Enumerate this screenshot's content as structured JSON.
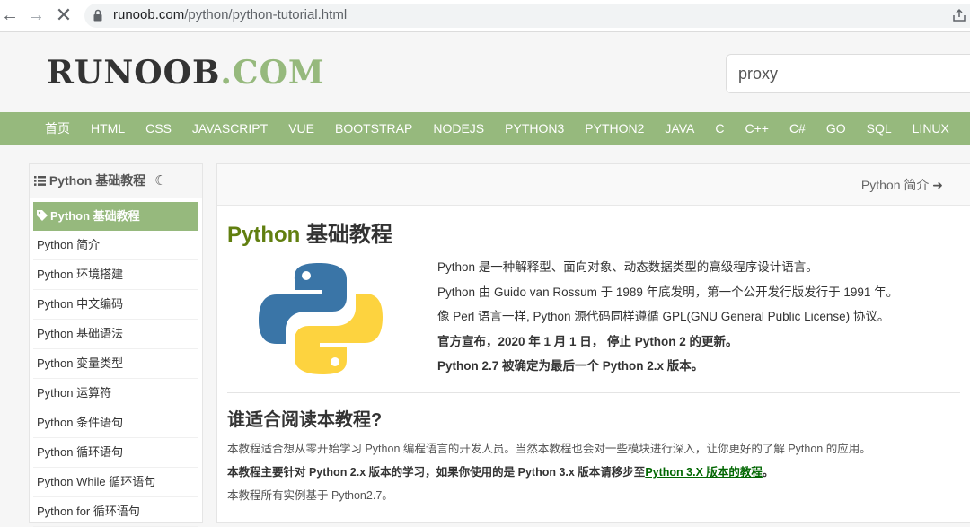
{
  "browser": {
    "url_host": "runoob.com",
    "url_path": "/python/python-tutorial.html",
    "back_icon": "arrow-left-icon",
    "forward_icon": "arrow-right-icon",
    "reload_icon": "stop-loading-icon"
  },
  "header": {
    "logo_main": "RUNOOB",
    "logo_dot": ".",
    "logo_com": "COM",
    "search_value": "proxy"
  },
  "colors": {
    "accent": "#96b97d",
    "title_green": "#617f10",
    "link_green": "#006600"
  },
  "nav": {
    "items": [
      "首页",
      "HTML",
      "CSS",
      "JAVASCRIPT",
      "VUE",
      "BOOTSTRAP",
      "NODEJS",
      "PYTHON3",
      "PYTHON2",
      "JAVA",
      "C",
      "C++",
      "C#",
      "GO",
      "SQL",
      "LINUX"
    ]
  },
  "sidebar": {
    "title": "Python 基础教程",
    "items": [
      "Python 基础教程",
      "Python 简介",
      "Python 环境搭建",
      "Python 中文编码",
      "Python 基础语法",
      "Python 变量类型",
      "Python 运算符",
      "Python 条件语句",
      "Python 循环语句",
      "Python While 循环语句",
      "Python for 循环语句"
    ]
  },
  "content": {
    "next_label": "Python 简介",
    "title_py": "Python",
    "title_rest": " 基础教程",
    "intro": [
      "Python 是一种解释型、面向对象、动态数据类型的高级程序设计语言。",
      "Python 由 Guido van Rossum 于 1989 年底发明，第一个公开发行版发行于 1991 年。",
      "像 Perl 语言一样, Python 源代码同样遵循 GPL(GNU General Public License) 协议。",
      "官方宣布，2020 年 1 月 1 日， 停止 Python 2 的更新。",
      "Python 2.7 被确定为最后一个 Python 2.x 版本。"
    ],
    "who_title": "谁适合阅读本教程?",
    "who_p1": "本教程适合想从零开始学习 Python 编程语言的开发人员。当然本教程也会对一些模块进行深入，让你更好的了解 Python 的应用。",
    "who_p2_text": "本教程主要针对 Python 2.x 版本的学习，如果你使用的是 Python 3.x 版本请移步至",
    "who_p2_link": "Python 3.X 版本的教程",
    "who_p2_end": "。",
    "who_p3": "本教程所有实例基于 Python2.7。"
  }
}
